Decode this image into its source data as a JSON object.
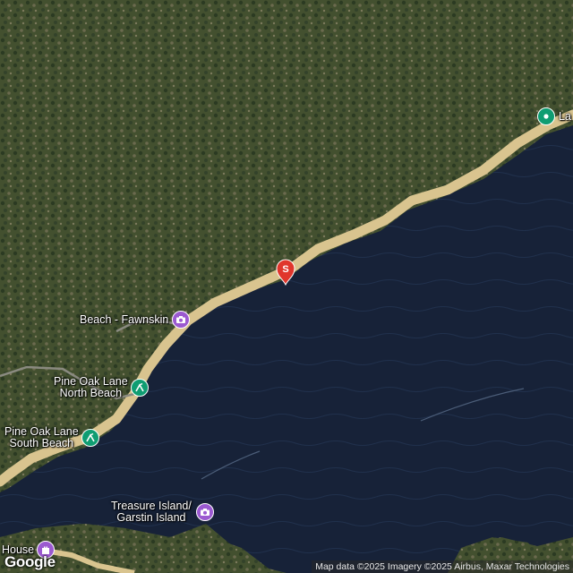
{
  "colors": {
    "forest": "#3d4a33",
    "lake": "#172238",
    "road": "#d9c48f",
    "park_marker": "#0f9d72",
    "attraction_marker": "#9b59d0",
    "search_pin": "#e0362c"
  },
  "pois": [
    {
      "name": "Beach - Fawnskin",
      "kind": "attraction",
      "icon": "camera-icon"
    },
    {
      "name": "Pine Oak Lane North Beach",
      "line1": "Pine Oak Lane",
      "line2": "North Beach",
      "kind": "park",
      "icon": "hiking-icon"
    },
    {
      "name": "Pine Oak Lane South Beach",
      "line1": "Pine Oak Lane",
      "line2": "South Beach",
      "kind": "park",
      "icon": "hiking-icon"
    },
    {
      "name": "Treasure Island/ Garstin Island",
      "line1": "Treasure Island/",
      "line2": "Garstin Island",
      "kind": "attraction",
      "icon": "camera-icon"
    },
    {
      "name": "House",
      "kind": "attraction",
      "icon": "castle-icon"
    },
    {
      "name": "La",
      "kind": "park",
      "icon": "location-icon"
    }
  ],
  "search_pin": {
    "label": "S"
  },
  "attribution": "Map data ©2025 Imagery ©2025 Airbus, Maxar Technologies",
  "logo": "Google"
}
